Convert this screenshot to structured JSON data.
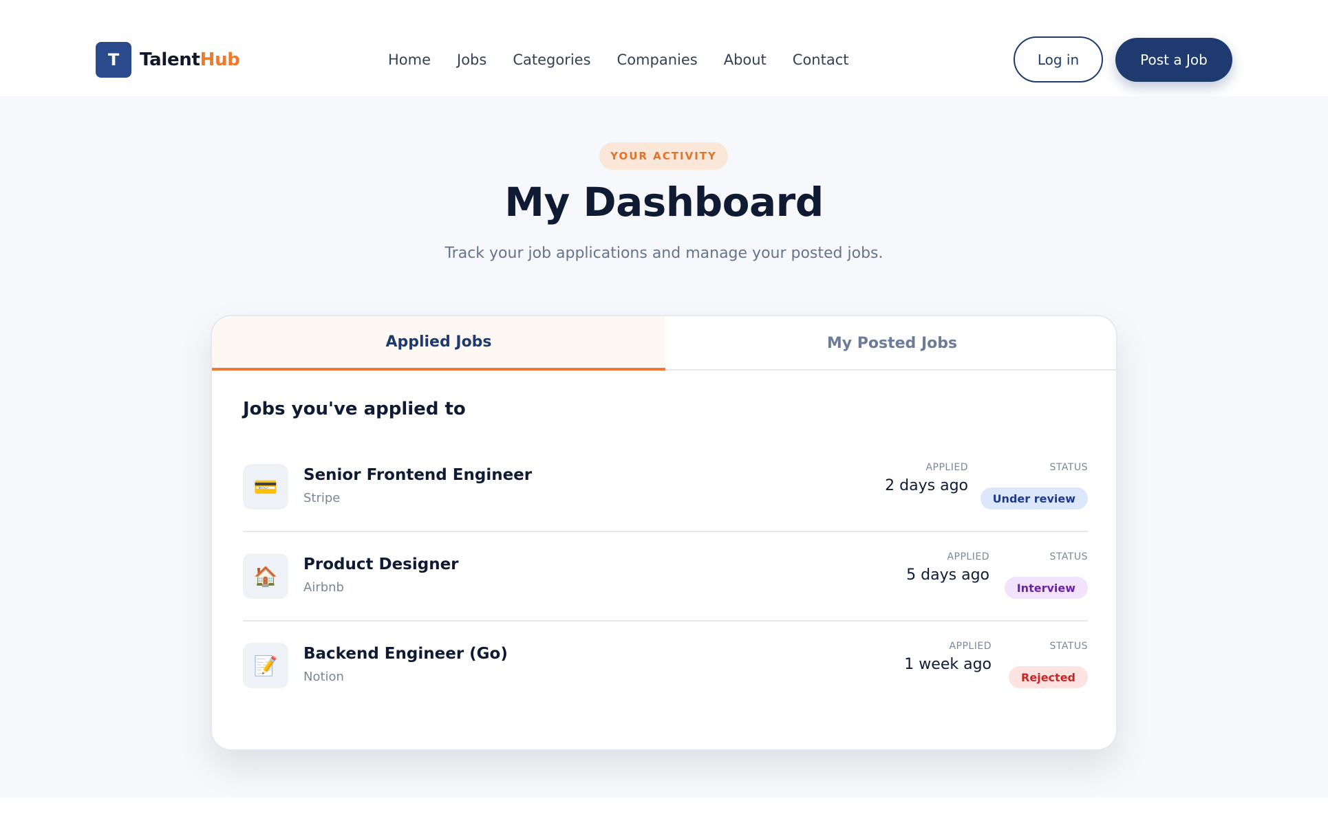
{
  "brand": {
    "logo_letter": "T",
    "name_part1": "Talent",
    "name_part2": "Hub",
    "accent": "#f07a2b",
    "primary": "#1e3a6e"
  },
  "nav": {
    "items": [
      "Home",
      "Jobs",
      "Categories",
      "Companies",
      "About",
      "Contact"
    ]
  },
  "header": {
    "login_label": "Log in",
    "post_job_label": "Post a Job"
  },
  "hero": {
    "eyebrow": "YOUR ACTIVITY",
    "title": "My Dashboard",
    "subtitle": "Track your job applications and manage your posted jobs."
  },
  "tabs": {
    "applied_label": "Applied Jobs",
    "posted_label": "My Posted Jobs",
    "active": "applied"
  },
  "applied": {
    "section_title": "Jobs you've applied to",
    "applied_header": "APPLIED",
    "status_header": "STATUS",
    "jobs": [
      {
        "title": "Senior Frontend Engineer",
        "company": "Stripe",
        "icon": "credit-card-icon",
        "icon_glyph": "💳",
        "applied": "2 days ago",
        "status": "Under review",
        "status_color": "#1e3a8a"
      },
      {
        "title": "Product Designer",
        "company": "Airbnb",
        "icon": "house-icon",
        "icon_glyph": "🏠",
        "applied": "5 days ago",
        "status": "Interview",
        "status_color": "#6b21a8"
      },
      {
        "title": "Backend Engineer (Go)",
        "company": "Notion",
        "icon": "memo-icon",
        "icon_glyph": "📝",
        "applied": "1 week ago",
        "status": "Rejected",
        "status_color": "#c62828"
      }
    ]
  }
}
